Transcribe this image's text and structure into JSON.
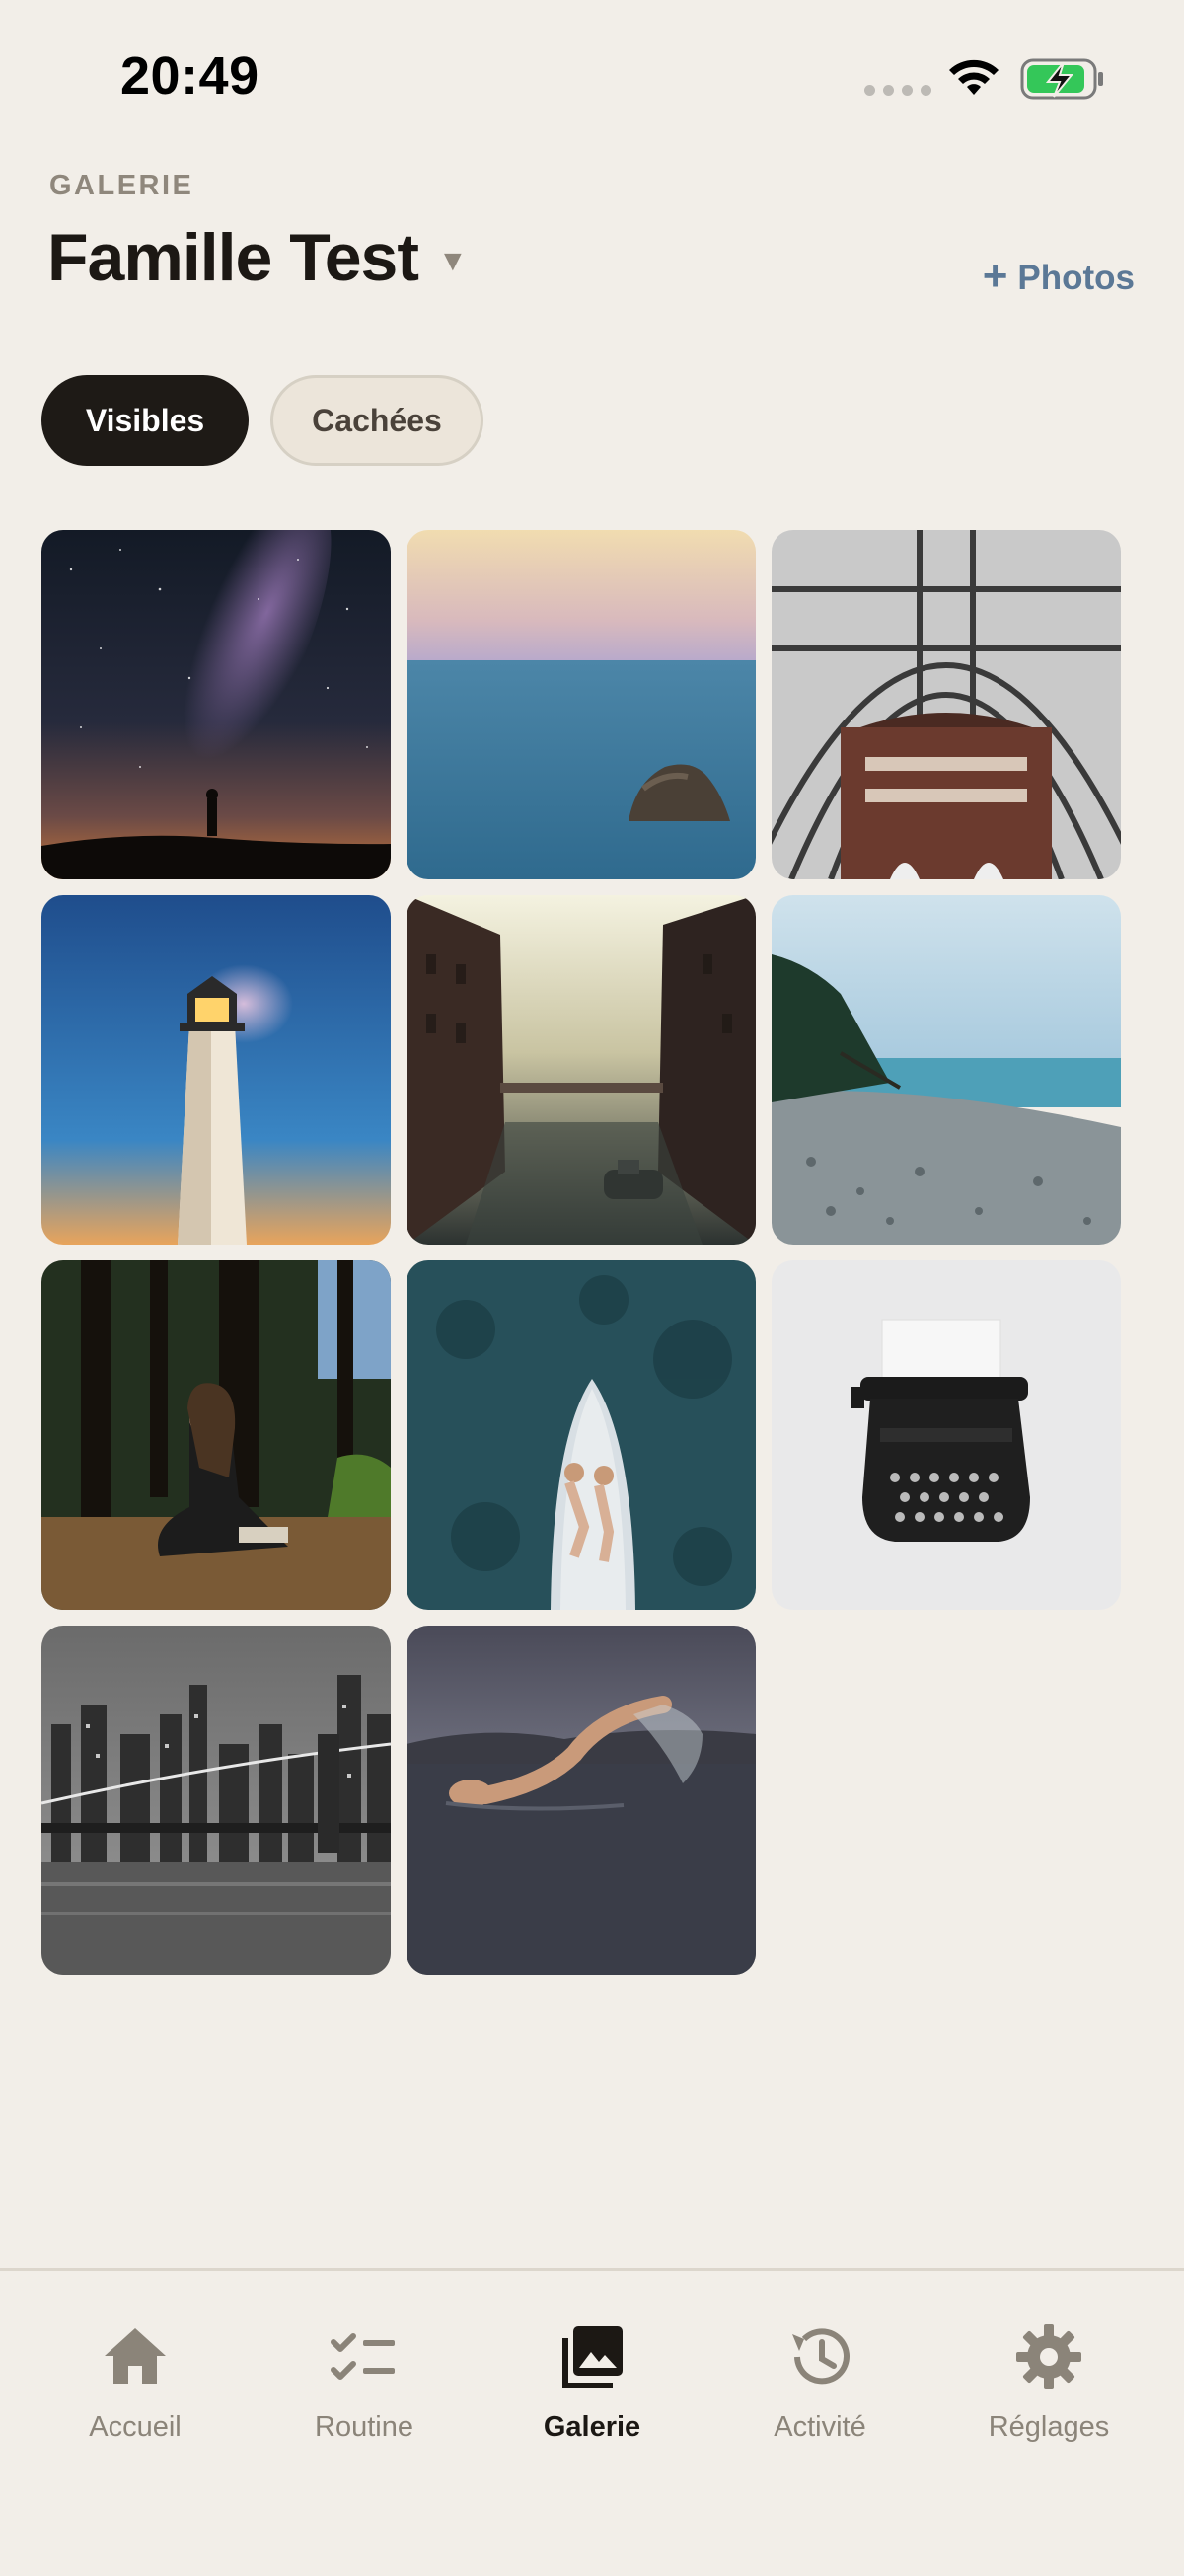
{
  "status": {
    "time": "20:49"
  },
  "header": {
    "eyebrow": "GALERIE",
    "title": "Famille Test",
    "caret": "▼",
    "add_photos_plus": "+",
    "add_photos_label": "Photos"
  },
  "segments": [
    {
      "label": "Visibles",
      "active": true
    },
    {
      "label": "Cachées",
      "active": false
    }
  ],
  "photos": [
    "Voie lactée avec silhouette",
    "Rocher dans la mer",
    "Verrière de gare",
    "Phare sous les étoiles",
    "Canal entre entrepôts",
    "Plage de galets",
    "Personne lisant en forêt",
    "Couple dans un bateau",
    "Machine à écrire",
    "Pont de Brooklyn en noir et blanc",
    "Nageur en eau sombre"
  ],
  "tabbar": {
    "items": [
      {
        "label": "Accueil",
        "icon": "home-icon",
        "active": false
      },
      {
        "label": "Routine",
        "icon": "checklist-icon",
        "active": false
      },
      {
        "label": "Galerie",
        "icon": "gallery-icon",
        "active": true
      },
      {
        "label": "Activité",
        "icon": "history-icon",
        "active": false
      },
      {
        "label": "Réglages",
        "icon": "gear-icon",
        "active": false
      }
    ]
  },
  "colors": {
    "background": "#f2eee8",
    "accent": "#5b7896",
    "active_chip": "#1e1a16",
    "muted_text": "#8b8479"
  }
}
